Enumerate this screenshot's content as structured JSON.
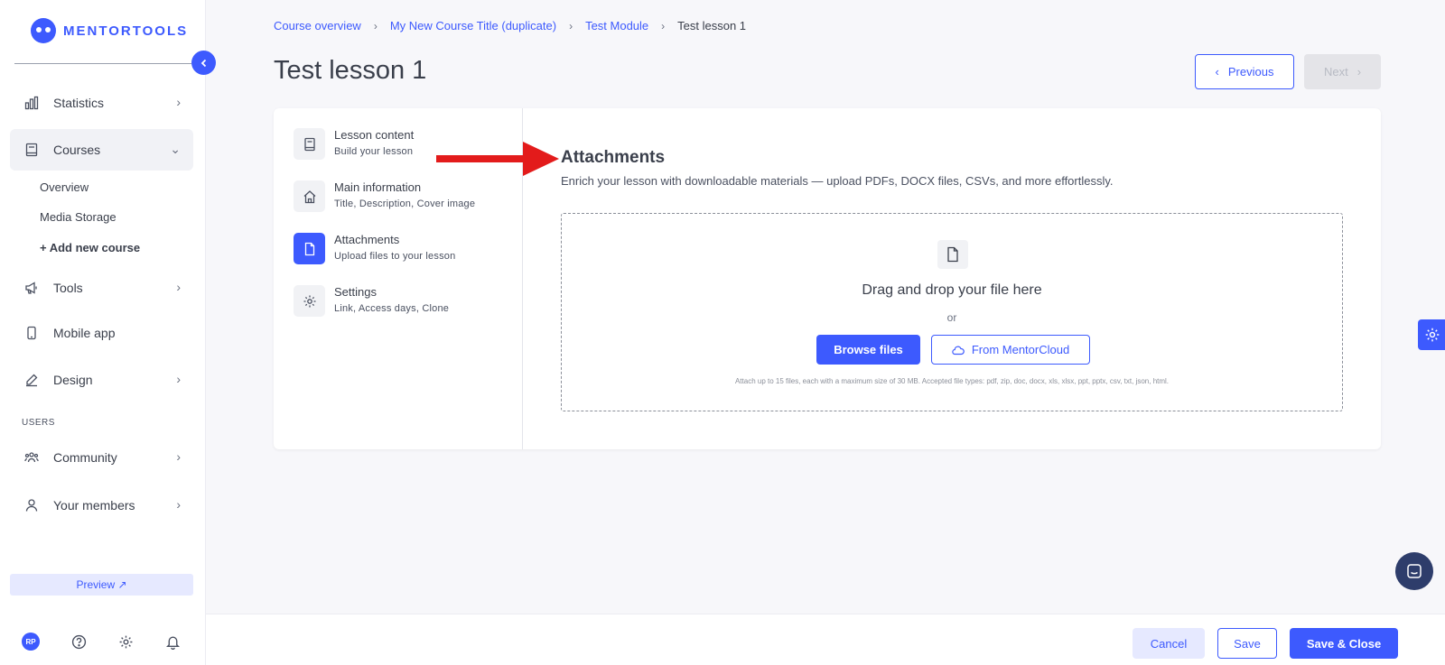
{
  "brand": {
    "name": "MENTORTOOLS",
    "accent": "#3d5afe"
  },
  "sidebar": {
    "items": [
      {
        "label": "Statistics",
        "icon": "bar-chart-icon"
      },
      {
        "label": "Courses",
        "icon": "book-icon"
      },
      {
        "label": "Tools",
        "icon": "megaphone-icon"
      },
      {
        "label": "Mobile app",
        "icon": "phone-icon"
      },
      {
        "label": "Design",
        "icon": "pencil-icon"
      },
      {
        "label": "Community",
        "icon": "people-icon"
      },
      {
        "label": "Your members",
        "icon": "user-icon"
      }
    ],
    "courses_sub": [
      "Overview",
      "Media Storage",
      "+ Add new course"
    ],
    "section_users": "USERS",
    "preview_label": "Preview ↗",
    "avatar_initials": "RP"
  },
  "breadcrumb": [
    "Course overview",
    "My New Course Title (duplicate)",
    "Test Module",
    "Test lesson 1"
  ],
  "page": {
    "title": "Test lesson 1",
    "previous_label": "Previous",
    "next_label": "Next"
  },
  "steps": [
    {
      "title": "Lesson content",
      "subtitle": "Build your lesson",
      "icon": "book-icon"
    },
    {
      "title": "Main information",
      "subtitle": "Title, Description, Cover image",
      "icon": "home-icon"
    },
    {
      "title": "Attachments",
      "subtitle": "Upload files to your lesson",
      "icon": "file-icon",
      "active": true
    },
    {
      "title": "Settings",
      "subtitle": "Link, Access days, Clone",
      "icon": "gear-icon"
    }
  ],
  "attachments": {
    "title": "Attachments",
    "description": "Enrich your lesson with downloadable materials — upload PDFs, DOCX files, CSVs, and more effortlessly.",
    "drop_text": "Drag and drop your file here",
    "or_text": "or",
    "browse_label": "Browse files",
    "cloud_label": "From MentorCloud",
    "note": "Attach up to 15 files, each with a maximum size of 30 MB. Accepted file types: pdf, zip, doc, docx, xls, xlsx, ppt, pptx, csv, txt, json, html."
  },
  "footer": {
    "cancel_label": "Cancel",
    "save_label": "Save",
    "save_close_label": "Save & Close"
  }
}
